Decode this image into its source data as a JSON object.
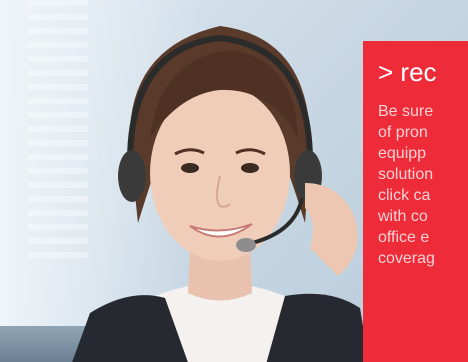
{
  "colors": {
    "panel_background": "#ee2b38",
    "panel_title_text": "#ffffff",
    "panel_body_text": "#ffd2d5"
  },
  "photo": {
    "subject": "woman-with-headset"
  },
  "panel": {
    "title": "> rec",
    "body_lines": [
      "Be sure",
      "of pron",
      "equipp",
      "solution",
      "click ca",
      "with co",
      "office e",
      "coverag"
    ]
  }
}
